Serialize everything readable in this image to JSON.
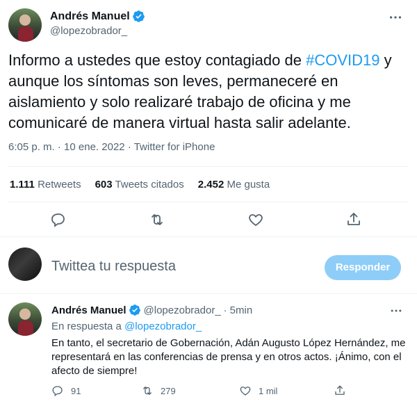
{
  "tweet": {
    "author_name": "Andrés Manuel",
    "author_handle": "@lopezobrador_",
    "body_pre": "Informo a ustedes que estoy contagiado de ",
    "hashtag": "#COVID19",
    "body_post": " y aunque los síntomas son leves, permaneceré en aislamiento y solo realizaré trabajo de oficina y me comunicaré de manera virtual hasta salir adelante.",
    "time": "6:05 p. m.",
    "sep": " · ",
    "date": "10 ene. 2022",
    "source": "Twitter for iPhone",
    "stats": {
      "retweets_count": "1.111",
      "retweets_label": "Retweets",
      "quotes_count": "603",
      "quotes_label": "Tweets citados",
      "likes_count": "2.452",
      "likes_label": "Me gusta"
    }
  },
  "reply_box": {
    "placeholder": "Twittea tu respuesta",
    "button_label": "Responder"
  },
  "reply_tweet": {
    "author_name": "Andrés Manuel",
    "author_handle": "@lopezobrador_",
    "dot": "·",
    "time_ago": "5min",
    "in_reply_prefix": "En respuesta a ",
    "in_reply_mention": "@lopezobrador_",
    "body": "En tanto, el secretario de Gobernación, Adán Augusto López Hernández, me representará en las conferencias de prensa y en otros actos. ¡Ánimo, con el afecto de siempre!",
    "replies": "91",
    "retweets": "279",
    "likes": "1 mil"
  },
  "colors": {
    "accent": "#1d9bf0",
    "muted": "#536471",
    "button_disabled": "#8ecdf8",
    "divider": "#eff3f4"
  },
  "icons": [
    "verified-badge-icon",
    "more-icon",
    "reply-icon",
    "retweet-icon",
    "like-icon",
    "share-icon"
  ]
}
